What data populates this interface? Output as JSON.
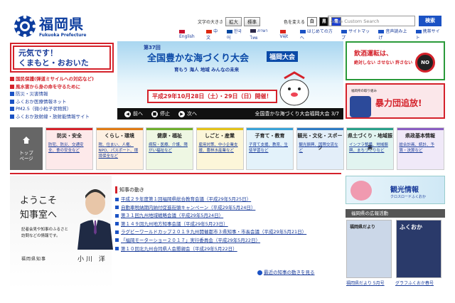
{
  "header": {
    "title": "福岡県",
    "subtitle": "Fukuoka Prefecture",
    "text_size_label": "文字の大きさ",
    "enlarge": "拡大",
    "standard": "標準",
    "color_label": "色を変える",
    "color_white": "白",
    "color_black": "黒",
    "color_blue": "青",
    "search_placeholder": "Custom Search",
    "search_button": "検索"
  },
  "lang_links": [
    {
      "label": "English",
      "color": "#c8102e"
    },
    {
      "label": "中文",
      "color": "#de2910"
    },
    {
      "label": "한국어",
      "color": "#0047a0"
    },
    {
      "label": "ภาษาไทย",
      "color": "#2d2a4a"
    },
    {
      "label": "Việt",
      "color": "#da251d"
    },
    {
      "label": "はじめての方へ",
      "color": "#1b52c4"
    },
    {
      "label": "サイトマップ",
      "color": "#1b52c4"
    },
    {
      "label": "音声読み上げ",
      "color": "#1b52c4"
    },
    {
      "label": "携帯サイト",
      "color": "#1b52c4"
    }
  ],
  "left_box": {
    "line1": "元気です！",
    "line2": "くまもと・おおいた"
  },
  "alerts": [
    {
      "text": "国民保護(弾道ミサイルへの対応など)",
      "style": "red"
    },
    {
      "text": "風水害から身の命を守るために",
      "style": "red"
    },
    {
      "text": "防災・災害情報",
      "style": "blu"
    },
    {
      "text": "ふくおか医療情報ネット",
      "style": "blu"
    },
    {
      "text": "PM2.5（微小粒子状物質）",
      "style": "blu"
    },
    {
      "text": "ふくおか放射線・放射能情報サイト",
      "style": "blu"
    }
  ],
  "banner": {
    "edition": "第37回",
    "title": "全国豊かな海づくり大会",
    "badge": "福岡大会",
    "slogan": "育もう 海人 地域 みんなの未来",
    "date": "平成29年10月28日（土）・29日（日）開催！",
    "prev": "前へ",
    "stop": "停止",
    "next": "次へ",
    "caption": "全国豊かな海づくり大会福岡大会 3/7"
  },
  "right_banners": {
    "drunk_title": "飲酒運転は、",
    "drunk_sub": "絶対しない させない 許さない",
    "drunk_no": "NO",
    "gang_small": "福岡県の取り組み",
    "gang_title": "暴力団追放!"
  },
  "nav": {
    "home": "トップ\nページ",
    "categories": [
      {
        "head": "防災・安全",
        "body": "防犯、防災、交通安全、食の安全など",
        "color": "#d4222b",
        "bg": "#fde9ea"
      },
      {
        "head": "くらし・環境",
        "body": "税、住まい、人権、NPO、パスポート、環境保全など",
        "color": "#e07b16",
        "bg": "#fdf0e2"
      },
      {
        "head": "健康・福祉",
        "body": "病院・医療、介護、障がい福祉など",
        "color": "#6fae2e",
        "bg": "#eef7e3"
      },
      {
        "head": "しごと・産業",
        "body": "雇用対策、中小企業支援、農林水産業など",
        "color": "#e3c319",
        "bg": "#fcf6d9"
      },
      {
        "head": "子育て・教育",
        "body": "子育て支援、教育、生徒学習など",
        "color": "#3aa3d8",
        "bg": "#e3f2fa"
      },
      {
        "head": "観光・文化・スポーツ",
        "body": "観光振興、国際交流など",
        "color": "#2e7bc4",
        "bg": "#e3eef9"
      },
      {
        "head": "県土づくり・地域振興",
        "body": "インフラ整備、地域振興、まちづくりなど",
        "color": "#2aa08a",
        "bg": "#e1f4f0"
      },
      {
        "head": "県政基本情報",
        "body": "総合計画、統計、予算・決算など",
        "color": "#8a5ec2",
        "bg": "#f0e9f8"
      }
    ]
  },
  "governor": {
    "welcome1": "ようこそ",
    "welcome2": "知事室へ",
    "desc": "記者会見や知事のふるさと訪問などの情報です。",
    "role": "福岡県知事",
    "name": "小川 洋"
  },
  "news": {
    "heading": "知事の動き",
    "items": [
      "平成２９年度第１回福岡県総合教育会議（平成29年5月25日）",
      "自動車税納期内納付促進街頭キャンペーン（平成29年5月24日）",
      "第３１回九州地域戦略会議（平成29年5月24日）",
      "第１４９回九州地方知事会議（平成29年5月23日）",
      "ラグビーワールドカップ２０１９九州開催都市３県知事・市長会議（平成29年5月21日）",
      "「福岡モーターショー２０１７」実行委員会（平成29年5月22日）",
      "第１０回北九州合同県人会懇親会（平成29年5月22日）"
    ],
    "more": "最近の知事の動きを見る"
  },
  "side": {
    "kanko_title": "観光情報",
    "kanko_sub": "クロスロードふくおか",
    "koho_heading": "福岡県の広報活動",
    "mag1_title": "福岡県だより",
    "mag2_title": "ふくおか",
    "cap1": "福岡県だより 5月号",
    "cap2": "グラフふくおか春号"
  }
}
